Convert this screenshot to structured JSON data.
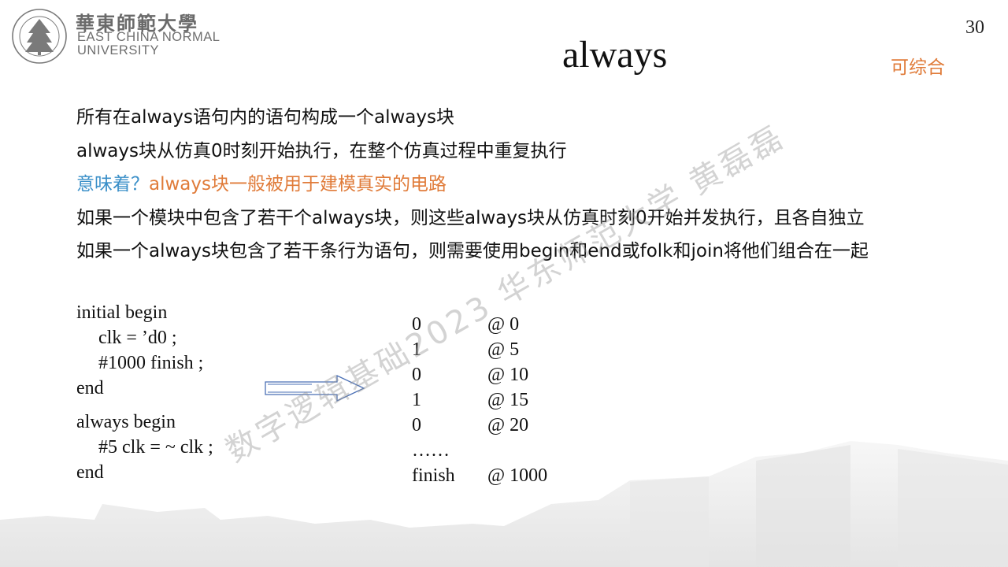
{
  "header": {
    "logo": {
      "cn_name": "華東師範大學",
      "en_line1": "EAST CHINA NORMAL",
      "en_line2": "UNIVERSITY"
    },
    "page_number": "30"
  },
  "slide": {
    "title": "always",
    "tag": "可综合",
    "bullets": [
      "所有在always语句内的语句构成一个always块",
      "always块从仿真0时刻开始执行，在整个仿真过程中重复执行",
      "如果一个模块中包含了若干个always块，则这些always块从仿真时刻0开始并发执行，且各自独立",
      "如果一个always块包含了若干条行为语句，则需要使用begin和end或folk和join将他们组合在一起"
    ],
    "question": {
      "prefix": "意味着？",
      "answer": "always块一般被用于建模真实的电路"
    }
  },
  "code": {
    "initial": [
      "initial begin",
      "clk = ’d0 ;",
      "#1000 finish ;",
      "end"
    ],
    "always": [
      "always begin",
      "#5 clk = ~ clk ;",
      "end"
    ]
  },
  "output": {
    "rows": [
      {
        "value": "0",
        "time": "@ 0"
      },
      {
        "value": "1",
        "time": "@ 5"
      },
      {
        "value": "0",
        "time": "@ 10"
      },
      {
        "value": "1",
        "time": "@ 15"
      },
      {
        "value": "0",
        "time": "@ 20"
      },
      {
        "value": "……",
        "time": ""
      },
      {
        "value": "finish",
        "time": "@ 1000"
      }
    ]
  },
  "watermark": "数字逻辑基础2023 华东师范大学 黄磊磊",
  "colors": {
    "accent_orange": "#e07b39",
    "question_blue": "#3a8fc8",
    "arrow_blue": "#4a6fb5"
  }
}
